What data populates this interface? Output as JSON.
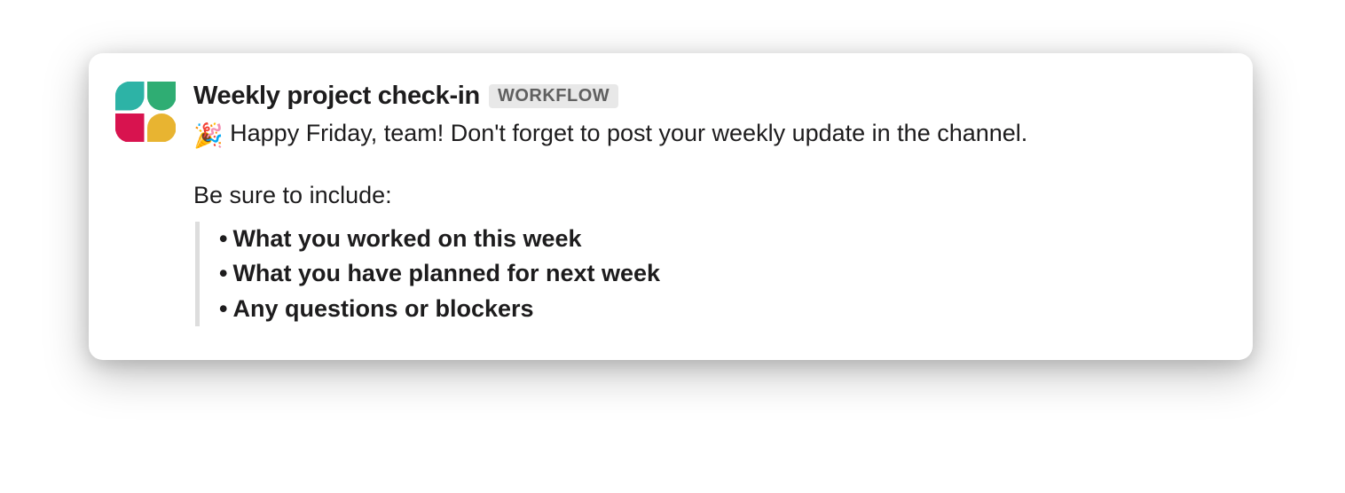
{
  "message": {
    "sender_name": "Weekly project check-in",
    "badge_label": "WORKFLOW",
    "greeting_emoji": "🎉",
    "greeting_text": "Happy Friday, team! Don't forget to post your weekly update in the channel.",
    "include_label": "Be sure to include:",
    "bullets": {
      "0": "What you worked on this week",
      "1": "What you have planned for next week",
      "2": "Any questions or blockers"
    }
  },
  "avatar_colors": {
    "tl": "#2db3a6",
    "tr": "#2fad73",
    "bl": "#d8134f",
    "br": "#e8b431"
  }
}
